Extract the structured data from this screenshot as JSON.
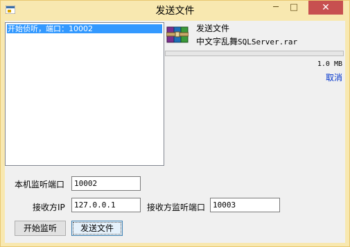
{
  "window": {
    "title": "发送文件",
    "controls": {
      "minimize": "─",
      "maximize": "□",
      "close": "✕"
    }
  },
  "log": {
    "items": [
      "开始侦听，端口：10002"
    ]
  },
  "transfer": {
    "heading": "发送文件",
    "file_name_cn": "中文字乱舞",
    "file_name_ext": "SQLServer.rar",
    "progress": 0,
    "size": "1.0 MB",
    "cancel_label": "取消"
  },
  "form": {
    "local_port_label": "本机监听端口",
    "local_port_value": "10002",
    "receiver_ip_label": "接收方IP",
    "receiver_ip_value": "127.0.0.1",
    "receiver_port_label": "接收方监听端口",
    "receiver_port_value": "10003"
  },
  "buttons": {
    "start_listen": "开始监听",
    "send_file": "发送文件"
  },
  "colors": {
    "titlebar": "#f8e8b0",
    "close": "#c75050",
    "selection": "#3399ff",
    "link": "#0033cc"
  }
}
